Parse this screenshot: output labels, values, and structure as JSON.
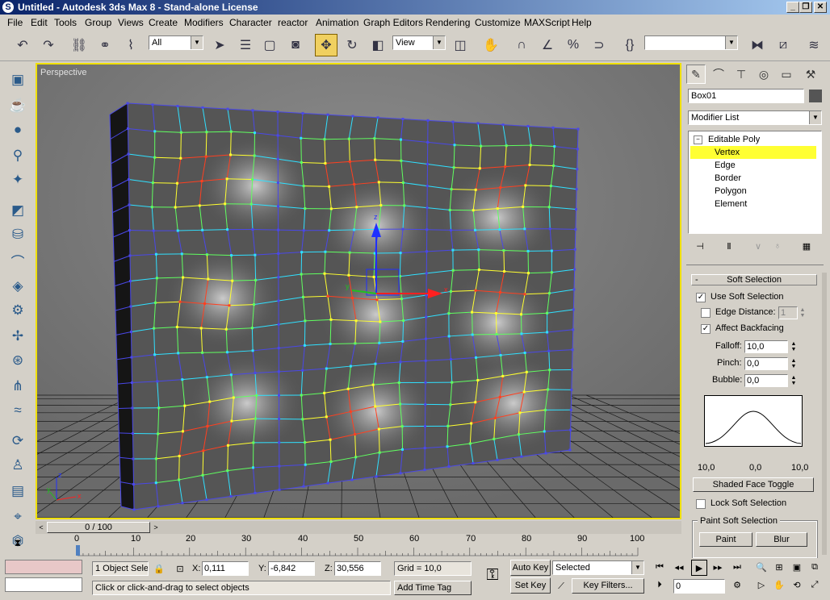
{
  "window": {
    "title": "Untitled - Autodesk 3ds Max 8  - Stand-alone License",
    "app_icon": "3ds-max-icon"
  },
  "menu": [
    "File",
    "Edit",
    "Tools",
    "Group",
    "Views",
    "Create",
    "Modifiers",
    "Character",
    "reactor",
    "Animation",
    "Graph Editors",
    "Rendering",
    "Customize",
    "MAXScript",
    "Help"
  ],
  "toolbar": {
    "selection_filter": "All",
    "ref_coord": "View",
    "named_selection": ""
  },
  "viewport": {
    "label": "Perspective",
    "axis_labels": {
      "x": "x",
      "y": "y",
      "z": "z"
    }
  },
  "command_panel": {
    "object_name": "Box01",
    "modifier_list": "Modifier List",
    "stack": {
      "root": "Editable Poly",
      "sub": [
        "Vertex",
        "Edge",
        "Border",
        "Polygon",
        "Element"
      ],
      "selected": "Vertex"
    },
    "soft_selection": {
      "title": "Soft Selection",
      "use_soft_selection": "Use Soft Selection",
      "edge_distance": "Edge Distance:",
      "edge_distance_value": "1",
      "affect_backfacing": "Affect Backfacing",
      "falloff_label": "Falloff:",
      "falloff": "10,0",
      "pinch_label": "Pinch:",
      "pinch": "0,0",
      "bubble_label": "Bubble:",
      "bubble": "0,0",
      "curve_labels": [
        "10,0",
        "0,0",
        "10,0"
      ],
      "shaded_face_toggle": "Shaded Face Toggle",
      "lock_soft_selection": "Lock Soft Selection",
      "paint_group": "Paint Soft Selection",
      "paint": "Paint",
      "blur": "Blur"
    }
  },
  "timeline": {
    "frame_display": "0 / 100",
    "ticks": [
      "0",
      "10",
      "20",
      "30",
      "40",
      "50",
      "60",
      "70",
      "80",
      "90",
      "100"
    ]
  },
  "status": {
    "selection": "1 Object Sele",
    "x_label": "X:",
    "x": "0,111",
    "y_label": "Y:",
    "y": "-6,842",
    "z_label": "Z:",
    "z": "30,556",
    "grid": "Grid = 10,0",
    "prompt": "Click or click-and-drag to select objects",
    "add_time_tag": "Add Time Tag",
    "auto_key": "Auto Key",
    "set_key": "Set Key",
    "key_mode": "Selected",
    "key_filters": "Key Filters...",
    "current_frame": "0"
  },
  "colors": {
    "title_start": "#0a246a",
    "title_end": "#a6caf0",
    "viewport_border": "#f0e000",
    "selected_highlight": "#ffff33",
    "wire": "#4040d0"
  }
}
